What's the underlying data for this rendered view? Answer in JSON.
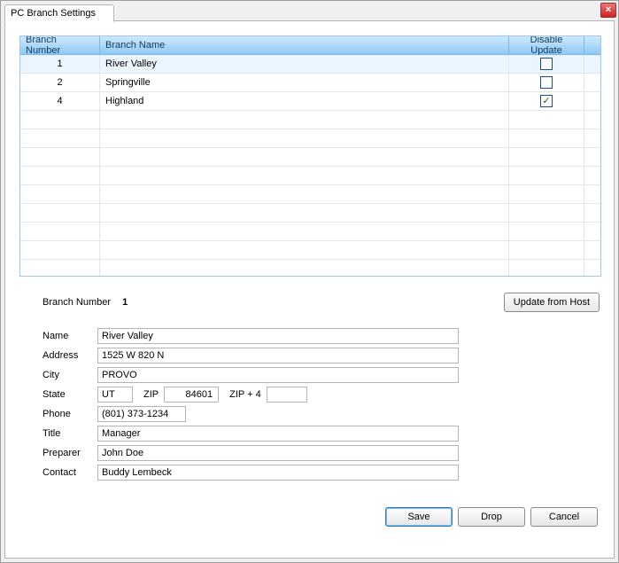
{
  "window": {
    "title": "PC Branch Settings"
  },
  "tab": {
    "label": "PC Branch Settings"
  },
  "grid": {
    "columns": {
      "branch_number": "Branch Number",
      "branch_name": "Branch Name",
      "disable_update": "Disable Update"
    },
    "rows": [
      {
        "number": "1",
        "name": "River Valley",
        "disabled": false,
        "selected": true
      },
      {
        "number": "2",
        "name": "Springville",
        "disabled": false,
        "selected": false
      },
      {
        "number": "4",
        "name": "Highland",
        "disabled": true,
        "selected": false
      }
    ],
    "blank_rows": 10
  },
  "details": {
    "branch_number_label": "Branch Number",
    "branch_number_value": "1",
    "update_from_host": "Update from Host",
    "labels": {
      "name": "Name",
      "address": "Address",
      "city": "City",
      "state": "State",
      "zip": "ZIP",
      "zip4": "ZIP + 4",
      "phone": "Phone",
      "title": "Title",
      "preparer": "Preparer",
      "contact": "Contact"
    },
    "values": {
      "name": "River Valley",
      "address": "1525 W 820 N",
      "city": "PROVO",
      "state": "UT",
      "zip": "84601",
      "zip4": "",
      "phone": "(801) 373-1234",
      "title": "Manager",
      "preparer": "John Doe",
      "contact": "Buddy Lembeck"
    }
  },
  "buttons": {
    "save": "Save",
    "drop": "Drop",
    "cancel": "Cancel"
  }
}
